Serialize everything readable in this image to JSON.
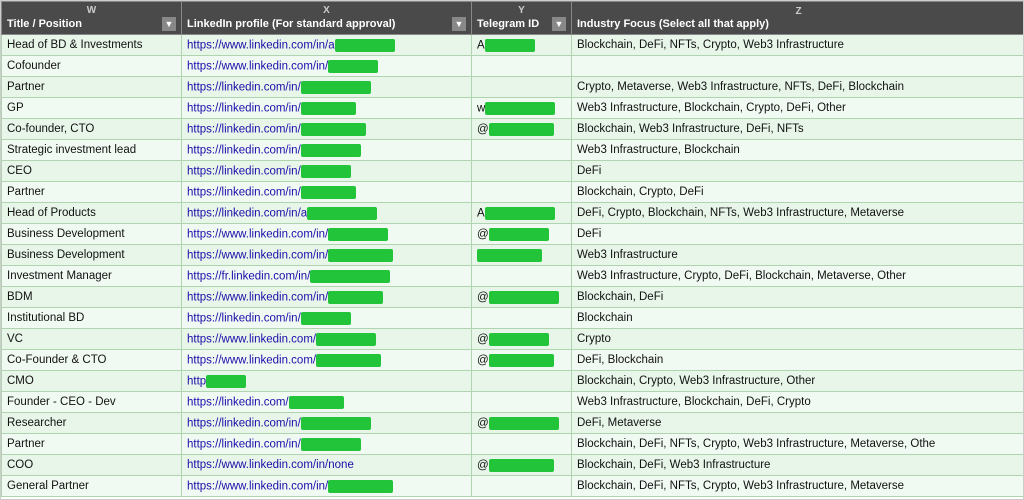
{
  "columns": {
    "w_label": "W",
    "x_label": "X",
    "y_label": "Y",
    "z_label": "Z",
    "w_header": "Title / Position",
    "x_header": "LinkedIn profile (For standard approval)",
    "y_header": "Telegram ID",
    "z_header": "Industry Focus (Select all that apply)"
  },
  "rows": [
    {
      "title": "Head of BD & Investments",
      "linkedin": "https://www.linkedin.com/in/a",
      "linkedin_suffix": true,
      "telegram": "A",
      "telegram_redact": true,
      "industry": "Blockchain, DeFi, NFTs, Crypto, Web3 Infrastructure"
    },
    {
      "title": "Cofounder",
      "linkedin": "https://www.linkedin.com/in/",
      "linkedin_suffix": true,
      "telegram": "",
      "telegram_redact": false,
      "industry": ""
    },
    {
      "title": "Partner",
      "linkedin": "https://linkedin.com/in/",
      "linkedin_suffix": true,
      "telegram": "",
      "telegram_redact": false,
      "industry": "Crypto, Metaverse, Web3 Infrastructure, NFTs, DeFi, Blockchain"
    },
    {
      "title": "GP",
      "linkedin": "https://linkedin.com/in/",
      "linkedin_suffix": true,
      "telegram": "w",
      "telegram_redact": true,
      "industry": "Web3 Infrastructure, Blockchain, Crypto, DeFi, Other"
    },
    {
      "title": "Co-founder, CTO",
      "linkedin": "https://linkedin.com/in/",
      "linkedin_suffix": true,
      "telegram": "@",
      "telegram_redact": true,
      "industry": "Blockchain, Web3 Infrastructure, DeFi, NFTs"
    },
    {
      "title": "Strategic investment lead",
      "linkedin": "https://linkedin.com/in/",
      "linkedin_suffix": true,
      "telegram": "",
      "telegram_redact": false,
      "industry": "Web3 Infrastructure, Blockchain"
    },
    {
      "title": "CEO",
      "linkedin": "https://linkedin.com/in/",
      "linkedin_suffix": true,
      "telegram": "",
      "telegram_redact": false,
      "industry": "DeFi"
    },
    {
      "title": "Partner",
      "linkedin": "https://linkedin.com/in/",
      "linkedin_suffix": true,
      "telegram": "",
      "telegram_redact": false,
      "industry": "Blockchain, Crypto, DeFi"
    },
    {
      "title": "Head of Products",
      "linkedin": "https://linkedin.com/in/a",
      "linkedin_suffix": true,
      "telegram": "A",
      "telegram_redact": true,
      "industry": "DeFi, Crypto, Blockchain, NFTs, Web3 Infrastructure, Metaverse"
    },
    {
      "title": "Business Development",
      "linkedin": "https://www.linkedin.com/in/",
      "linkedin_suffix": true,
      "telegram": "@",
      "telegram_redact": true,
      "industry": "DeFi"
    },
    {
      "title": "Business Development",
      "linkedin": "https://www.linkedin.com/in/",
      "linkedin_suffix": true,
      "telegram": "",
      "telegram_redact": true,
      "industry": "Web3 Infrastructure"
    },
    {
      "title": "Investment Manager",
      "linkedin": "https://fr.linkedin.com/in/",
      "linkedin_suffix": true,
      "telegram": "",
      "telegram_redact": false,
      "industry": "Web3 Infrastructure, Crypto, DeFi, Blockchain, Metaverse, Other"
    },
    {
      "title": "BDM",
      "linkedin": "https://www.linkedin.com/in/",
      "linkedin_suffix": true,
      "telegram": "@",
      "telegram_redact": true,
      "industry": "Blockchain, DeFi"
    },
    {
      "title": "Institutional BD",
      "linkedin": "https://linkedin.com/in/",
      "linkedin_suffix": true,
      "telegram": "",
      "telegram_redact": false,
      "industry": "Blockchain"
    },
    {
      "title": "VC",
      "linkedin": "https://www.linkedin.com/",
      "linkedin_suffix": true,
      "telegram": "@",
      "telegram_redact": true,
      "industry": "Crypto"
    },
    {
      "title": "Co-Founder & CTO",
      "linkedin": "https://www.linkedin.com/",
      "linkedin_suffix": true,
      "telegram": "@",
      "telegram_redact": true,
      "industry": "DeFi, Blockchain"
    },
    {
      "title": "CMO",
      "linkedin": "http",
      "linkedin_suffix": true,
      "telegram": "",
      "telegram_redact": false,
      "industry": "Blockchain, Crypto, Web3 Infrastructure, Other"
    },
    {
      "title": "Founder - CEO - Dev",
      "linkedin": "https://linkedin.com/",
      "linkedin_suffix": true,
      "telegram": "",
      "telegram_redact": false,
      "industry": "Web3 Infrastructure, Blockchain, DeFi, Crypto"
    },
    {
      "title": "Researcher",
      "linkedin": "https://linkedin.com/in/",
      "linkedin_suffix": true,
      "telegram": "@",
      "telegram_redact": true,
      "industry": "DeFi, Metaverse"
    },
    {
      "title": "Partner",
      "linkedin": "https://linkedin.com/in/",
      "linkedin_suffix": true,
      "telegram": "",
      "telegram_redact": false,
      "industry": "Blockchain, DeFi, NFTs, Crypto, Web3 Infrastructure, Metaverse, Othe"
    },
    {
      "title": "COO",
      "linkedin": "https://www.linkedin.com/in/none",
      "linkedin_suffix": false,
      "telegram": "@",
      "telegram_redact": true,
      "industry": "Blockchain, DeFi, Web3 Infrastructure"
    },
    {
      "title": "General Partner",
      "linkedin": "https://www.linkedin.com/in/",
      "linkedin_suffix": true,
      "telegram": "",
      "telegram_redact": false,
      "industry": "Blockchain, DeFi, NFTs, Crypto, Web3 Infrastructure, Metaverse"
    }
  ]
}
